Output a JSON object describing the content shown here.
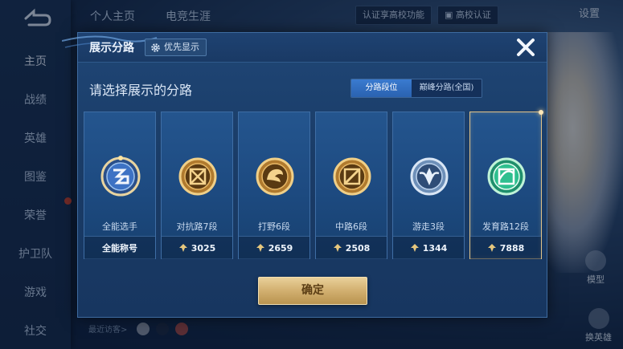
{
  "background": {
    "nav": [
      "主页",
      "战绩",
      "英雄",
      "图鉴",
      "荣誉",
      "护卫队",
      "游戏",
      "社交"
    ],
    "top_tabs": [
      "个人主页",
      "电竞生涯"
    ],
    "certify_button": "认证享高校功能",
    "college_button": "高校认证",
    "settings_label": "设置",
    "recent_visitors": "最近访客>",
    "side_buttons": [
      "模型",
      "换英雄"
    ]
  },
  "modal": {
    "title": "展示分路",
    "priority_label": "优先显示",
    "subtitle": "请选择展示的分路",
    "tabs": [
      {
        "label": "分路段位",
        "active": true
      },
      {
        "label": "巅峰分路(全国)",
        "active": false
      }
    ],
    "cards": [
      {
        "name": "全能选手",
        "footer": "全能称号",
        "has_points": false,
        "badge": "all-round-badge-icon",
        "selected": false
      },
      {
        "name": "对抗路7段",
        "footer": "3025",
        "has_points": true,
        "badge": "clash-lane-badge-icon",
        "selected": false
      },
      {
        "name": "打野6段",
        "footer": "2659",
        "has_points": true,
        "badge": "jungle-badge-icon",
        "selected": false
      },
      {
        "name": "中路6段",
        "footer": "2508",
        "has_points": true,
        "badge": "mid-lane-badge-icon",
        "selected": false
      },
      {
        "name": "游走3段",
        "footer": "1344",
        "has_points": true,
        "badge": "roam-badge-icon",
        "selected": false
      },
      {
        "name": "发育路12段",
        "footer": "7888",
        "has_points": true,
        "badge": "farm-lane-badge-icon",
        "selected": true
      }
    ],
    "confirm_label": "确定"
  },
  "colors": {
    "modal_bg": "#1a3c67",
    "selected_border": "#e2c489",
    "confirm_gold": "#d4b273",
    "tab_active": "#3a7bd0",
    "farm_badge_green": "#2fbf8f"
  }
}
